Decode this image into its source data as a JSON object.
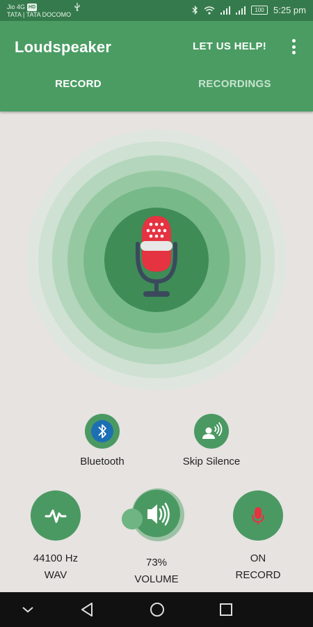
{
  "status": {
    "carrier1": "Jio 4G",
    "carrier1_badge": "HD",
    "carrier2": "TATA | TATA DOCOMO",
    "battery": "100",
    "time": "5:25 pm"
  },
  "app": {
    "title": "Loudspeaker",
    "help_label": "LET US HELP!",
    "tabs": [
      "RECORD",
      "RECORDINGS"
    ],
    "active_tab": "RECORD"
  },
  "options": {
    "bluetooth_label": "Bluetooth",
    "skip_silence_label": "Skip Silence"
  },
  "controls": {
    "format": {
      "sample_rate": "44100 Hz",
      "type": "WAV"
    },
    "volume": {
      "value": "73%",
      "label": "VOLUME"
    },
    "record_mode": {
      "state": "ON",
      "label": "RECORD"
    }
  },
  "colors": {
    "primary": "#4a9c63",
    "status_bar": "#357a4c",
    "button": "#4b9962",
    "mic_red": "#e53341",
    "background": "#e6e3e1"
  },
  "icons": {
    "mic": "microphone-icon",
    "bluetooth": "bluetooth-icon",
    "skip": "speaking-person-icon",
    "waveform": "waveform-icon",
    "speaker": "speaker-icon",
    "record": "microphone-small-icon"
  }
}
